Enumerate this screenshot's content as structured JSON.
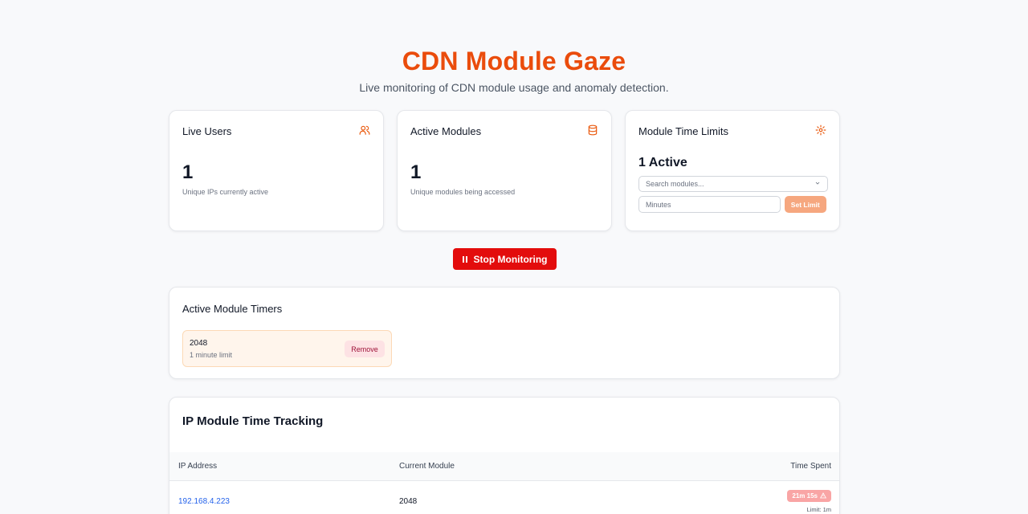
{
  "header": {
    "title": "CDN Module Gaze",
    "subtitle": "Live monitoring of CDN module usage and anomaly detection."
  },
  "cards": {
    "live_users": {
      "title": "Live Users",
      "value": "1",
      "desc": "Unique IPs currently active",
      "icon": "users-icon"
    },
    "active_modules": {
      "title": "Active Modules",
      "value": "1",
      "desc": "Unique modules being accessed",
      "icon": "database-icon"
    },
    "time_limits": {
      "title": "Module Time Limits",
      "active_label": "1 Active",
      "search_placeholder": "Search modules...",
      "minutes_placeholder": "Minutes",
      "set_limit_label": "Set Limit",
      "icon": "gear-icon"
    }
  },
  "controls": {
    "stop_label": "Stop Monitoring"
  },
  "timers": {
    "title": "Active Module Timers",
    "items": [
      {
        "name": "2048",
        "limit": "1 minute limit",
        "remove_label": "Remove"
      }
    ]
  },
  "tracking": {
    "title": "IP Module Time Tracking",
    "columns": [
      "IP Address",
      "Current Module",
      "Time Spent"
    ],
    "rows": [
      {
        "ip": "192.168.4.223",
        "module": "2048",
        "time": "21m 15s",
        "limit": "Limit: 1m"
      }
    ]
  },
  "colors": {
    "accent": "#ea4c0c",
    "danger": "#e30c0c",
    "link": "#2563eb"
  }
}
